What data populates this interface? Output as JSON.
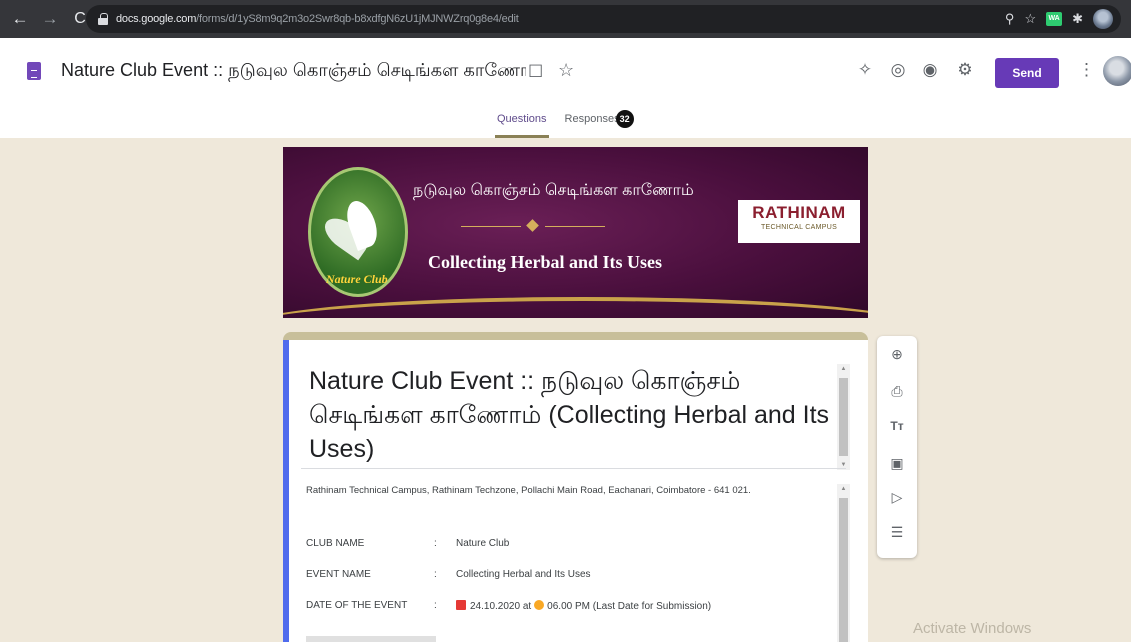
{
  "browser": {
    "url_host": "docs.google.com",
    "url_path": "/forms/d/1yS8m9q2m3o2Swr8qb-b8xdfgN6zU1jMJNWZrq0g8e4/edit",
    "ext_wa_label": "WA",
    "icons": {
      "back": "arrow-left",
      "forward": "arrow-right",
      "reload": "reload",
      "lock": "lock",
      "zoom": "magnifier",
      "bookmark": "star",
      "extensions": "puzzle-piece"
    }
  },
  "header": {
    "title": "Nature Club Event :: நடுவுல கொஞ்சம் செடிங்கள காணோம் (Collecting Herbal and Its Uses)",
    "send_label": "Send",
    "accent_color": "#673ab7",
    "tabs": [
      {
        "label": "Questions",
        "active": true
      },
      {
        "label": "Responses",
        "badge": "32",
        "active": false
      }
    ],
    "icons": [
      "addons-icon",
      "palette-icon",
      "preview-icon",
      "settings-icon"
    ]
  },
  "banner": {
    "tamil_title": "நடுவுல கொஞ்சம் செடிங்கள காணோம்",
    "english_title": "Collecting Herbal and Its Uses",
    "logo_text": "Nature Club",
    "org_name": "RATHINAM",
    "org_subtitle": "TECHNICAL CAMPUS"
  },
  "form": {
    "title": "Nature Club Event :: நடுவுல கொஞ்சம் செடிங்கள காணோம் (Collecting Herbal and Its Uses)",
    "address": "Rathinam Technical Campus, Rathinam Techzone, Pollachi Main Road, Eachanari, Coimbatore - 641 021.",
    "details": [
      {
        "label": "CLUB NAME",
        "value": "Nature Club"
      },
      {
        "label": "EVENT NAME",
        "value": "Collecting Herbal and Its Uses"
      },
      {
        "label": "DATE OF THE EVENT",
        "date": "24.10.2020 at",
        "time": "06.00 PM (Last Date for Submission)"
      }
    ],
    "colon": ":"
  },
  "toolbar": {
    "items": [
      "add-question-icon",
      "import-questions-icon",
      "add-title-icon",
      "add-image-icon",
      "add-video-icon",
      "add-section-icon"
    ]
  },
  "watermark": "Activate Windows"
}
